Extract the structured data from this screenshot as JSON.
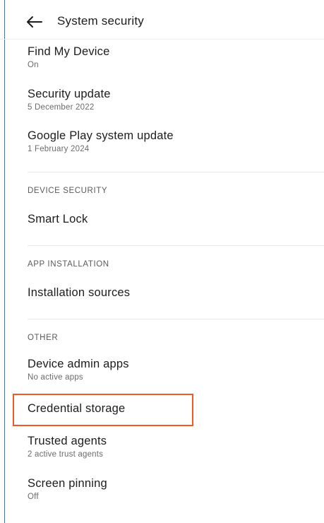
{
  "header": {
    "title": "System security",
    "back_icon": "arrow-back-icon"
  },
  "items": {
    "find_my_device": {
      "title": "Find My Device",
      "subtitle": "On"
    },
    "security_update": {
      "title": "Security update",
      "subtitle": "5 December 2022"
    },
    "play_system_update": {
      "title": "Google Play system update",
      "subtitle": "1 February 2024"
    },
    "smart_lock": {
      "title": "Smart Lock"
    },
    "installation_sources": {
      "title": "Installation sources"
    },
    "device_admin_apps": {
      "title": "Device admin apps",
      "subtitle": "No active apps"
    },
    "credential_storage": {
      "title": "Credential storage"
    },
    "trusted_agents": {
      "title": "Trusted agents",
      "subtitle": "2 active trust agents"
    },
    "screen_pinning": {
      "title": "Screen pinning",
      "subtitle": "Off"
    }
  },
  "sections": {
    "device_security": "DEVICE SECURITY",
    "app_installation": "APP INSTALLATION",
    "other": "OTHER"
  },
  "colors": {
    "highlight": "#f15a22",
    "left_edge": "#4a6ea8"
  }
}
